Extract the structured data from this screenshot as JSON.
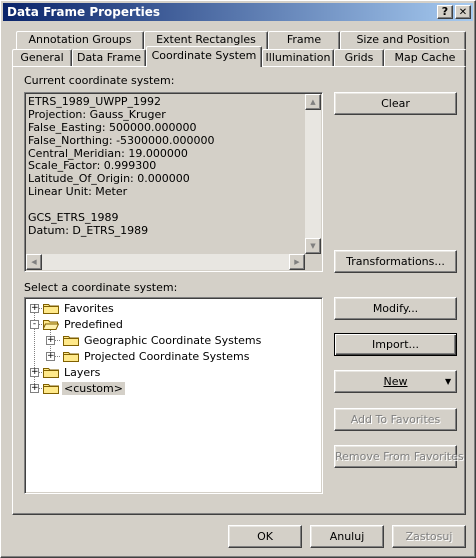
{
  "window": {
    "title": "Data Frame Properties",
    "help_button": "?",
    "close_button": "X"
  },
  "tabs": {
    "row_back": [
      "Annotation Groups",
      "Extent Rectangles",
      "Frame",
      "Size and Position"
    ],
    "row_front": [
      "General",
      "Data Frame",
      "Coordinate System",
      "Illumination",
      "Grids",
      "Map Cache"
    ],
    "active": "Coordinate System"
  },
  "current_cs": {
    "label": "Current coordinate system:",
    "lines": [
      "ETRS_1989_UWPP_1992",
      "Projection: Gauss_Kruger",
      "False_Easting: 500000.000000",
      "False_Northing: -5300000.000000",
      "Central_Meridian: 19.000000",
      "Scale_Factor: 0.999300",
      "Latitude_Of_Origin: 0.000000",
      "Linear Unit: Meter",
      "",
      "GCS_ETRS_1989",
      "Datum: D_ETRS_1989"
    ]
  },
  "select_cs": {
    "label": "Select a coordinate system:",
    "tree": [
      {
        "label": "Favorites",
        "expander": "+"
      },
      {
        "label": "Predefined",
        "expander": "-"
      },
      {
        "label": "Geographic Coordinate Systems",
        "expander": "+"
      },
      {
        "label": "Projected Coordinate Systems",
        "expander": "+"
      },
      {
        "label": "Layers",
        "expander": "+"
      },
      {
        "label": "<custom>",
        "expander": "+"
      }
    ]
  },
  "buttons": {
    "clear": "Clear",
    "transformations": "Transformations...",
    "modify": "Modify...",
    "import": "Import...",
    "new": "New",
    "add_to_favorites": "Add To Favorites",
    "remove_from_favorites": "Remove From Favorites",
    "ok": "OK",
    "cancel": "Anuluj",
    "apply": "Zastosuj"
  }
}
